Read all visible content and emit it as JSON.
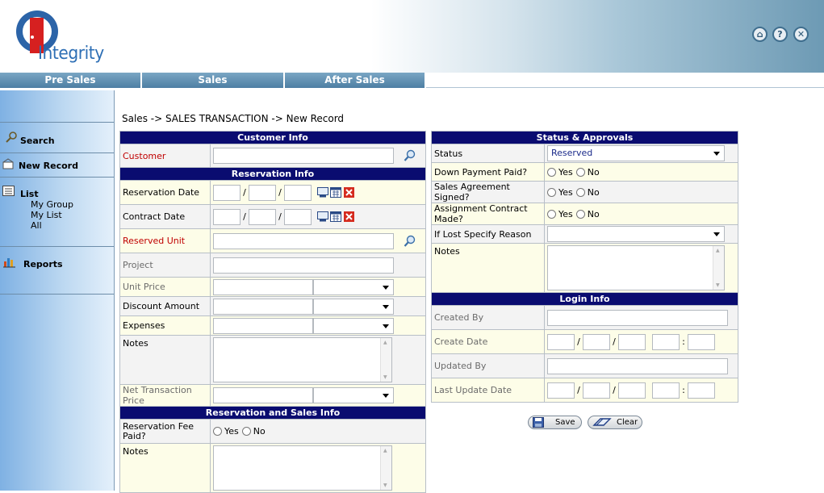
{
  "logo": {
    "text": "Integrity"
  },
  "header_icons": [
    "home-icon",
    "help-icon",
    "close-icon"
  ],
  "nav": {
    "tabs": [
      "Pre Sales",
      "Sales",
      "After Sales"
    ]
  },
  "sidebar": {
    "search": "Search",
    "new_record": "New Record",
    "list": "List",
    "list_items": [
      "My Group",
      "My List",
      "All"
    ],
    "reports": "Reports"
  },
  "breadcrumb": "Sales -> SALES TRANSACTION -> New Record",
  "customer_info": {
    "title": "Customer Info",
    "customer_label": "Customer"
  },
  "reservation_info": {
    "title": "Reservation Info",
    "reservation_date": "Reservation Date",
    "contract_date": "Contract Date",
    "reserved_unit": "Reserved Unit",
    "project": "Project",
    "unit_price": "Unit Price",
    "discount_amount": "Discount Amount",
    "expenses": "Expenses",
    "notes": "Notes",
    "net_price": "Net Transaction Price",
    "date_sep": "/"
  },
  "res_sales_info": {
    "title": "Reservation and Sales Info",
    "fee_paid": "Reservation Fee Paid?",
    "notes": "Notes",
    "yes": "Yes",
    "no": "No"
  },
  "status": {
    "title": "Status & Approvals",
    "status_label": "Status",
    "status_value": "Reserved",
    "down_payment": "Down Payment Paid?",
    "agreement_signed": "Sales Agreement Signed?",
    "assignment_contract": "Assignment Contract Made?",
    "lost_reason": "If Lost Specify Reason",
    "notes": "Notes",
    "yes": "Yes",
    "no": "No"
  },
  "login_info": {
    "title": "Login Info",
    "created_by": "Created By",
    "create_date": "Create Date",
    "updated_by": "Updated By",
    "last_update_date": "Last Update Date",
    "date_sep": "/",
    "time_sep": ":"
  },
  "buttons": {
    "save": "Save",
    "clear": "Clear"
  },
  "colors": {
    "section_header": "#0a0c70",
    "required_label": "#c00000",
    "nav_tab": "#5f8db0"
  }
}
